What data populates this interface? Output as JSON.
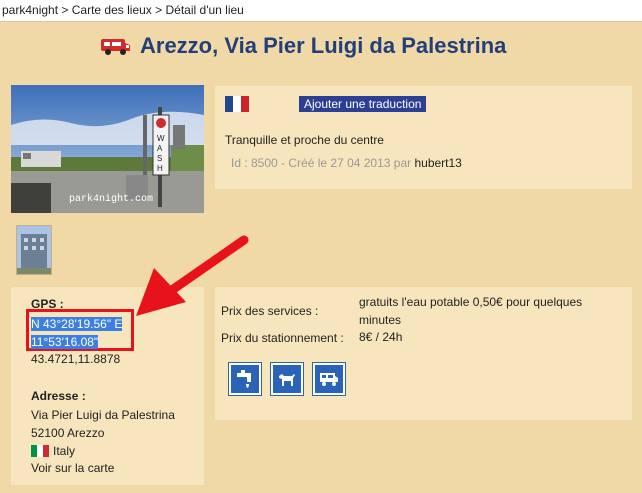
{
  "breadcrumb": {
    "home": "park4night",
    "sep1": ">",
    "places_map": "Carte des lieux",
    "sep2": ">",
    "current": "Détail d'un lieu"
  },
  "place": {
    "title": "Arezzo, Via Pier Luigi da Palestrina",
    "photo_watermark": "park4night.com",
    "photo_sign": "WASH"
  },
  "info": {
    "translate_button": "Ajouter une traduction",
    "description": "Tranquille et proche du centre",
    "meta_prefix": "Id : 8500 - Créé le 27 04 2013 par",
    "author": "hubert13"
  },
  "gps": {
    "label": "GPS :",
    "dms_line1": "N 43°28'19.56\" E",
    "dms_line2": "11°53'16.08\"",
    "decimal": "43.4721,11.8878"
  },
  "address": {
    "label": "Adresse :",
    "street": "Via Pier Luigi da Palestrina",
    "city": "52100 Arezzo",
    "country": "Italy",
    "map_link": "Voir sur la carte"
  },
  "services": {
    "price_services_label": "Prix des services :",
    "price_services_value": "gratuits l'eau potable 0,50€ pour quelques minutes",
    "price_parking_label": "Prix du stationnement :",
    "price_parking_value": "8€ / 24h",
    "icons": [
      "water-tap-icon",
      "pets-allowed-icon",
      "motorhome-service-icon"
    ]
  },
  "colors": {
    "background": "#f0d9a6",
    "panel": "#f7e6bd",
    "title": "#223f7a",
    "button": "#2b3f94",
    "highlight": "#3d7fe0",
    "annotation": "#e8131a"
  }
}
